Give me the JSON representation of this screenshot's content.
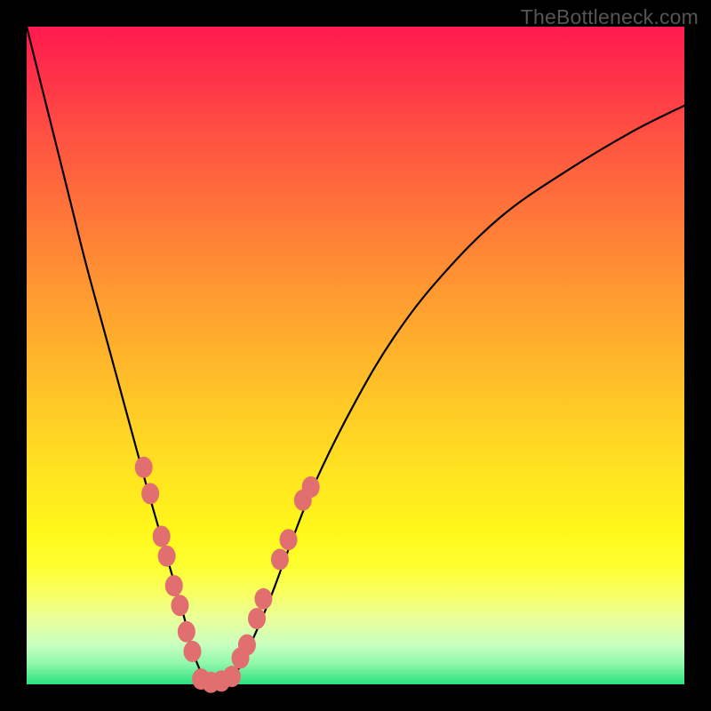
{
  "watermark": "TheBottleneck.com",
  "colors": {
    "curve": "#000000",
    "marker_fill": "#e26f6f",
    "marker_stroke": "#c75a5a",
    "background_black": "#000000"
  },
  "chart_data": {
    "type": "line",
    "title": "",
    "xlabel": "",
    "ylabel": "",
    "xlim": [
      0,
      100
    ],
    "ylim": [
      0,
      100
    ],
    "grid": false,
    "legend": false,
    "series": [
      {
        "name": "bottleneck-curve",
        "x": [
          0,
          3,
          6,
          9,
          12,
          15,
          18,
          20,
          22,
          24,
          25,
          26,
          27,
          28,
          29,
          30,
          32,
          34,
          37,
          40,
          44,
          50,
          56,
          63,
          72,
          82,
          92,
          100
        ],
        "y": [
          100,
          88,
          76,
          64,
          53,
          42,
          31,
          24,
          17,
          10,
          6,
          3,
          1,
          0,
          0,
          0,
          2,
          6,
          13,
          21,
          31,
          43,
          53,
          62,
          71,
          78,
          84,
          88
        ]
      }
    ],
    "markers_left": [
      {
        "x": 17.8,
        "y": 33
      },
      {
        "x": 18.8,
        "y": 29
      },
      {
        "x": 20.5,
        "y": 22.5
      },
      {
        "x": 21.3,
        "y": 19.5
      },
      {
        "x": 22.4,
        "y": 15
      },
      {
        "x": 23.3,
        "y": 12
      },
      {
        "x": 24.3,
        "y": 8
      },
      {
        "x": 25.2,
        "y": 5
      }
    ],
    "markers_bottom": [
      {
        "x": 26.5,
        "y": 0.8
      },
      {
        "x": 28.0,
        "y": 0.3
      },
      {
        "x": 29.6,
        "y": 0.5
      },
      {
        "x": 31.2,
        "y": 1.2
      }
    ],
    "markers_right": [
      {
        "x": 32.5,
        "y": 4
      },
      {
        "x": 33.5,
        "y": 6
      },
      {
        "x": 35.0,
        "y": 10
      },
      {
        "x": 36.0,
        "y": 13
      },
      {
        "x": 38.5,
        "y": 19
      },
      {
        "x": 39.8,
        "y": 22
      },
      {
        "x": 42.0,
        "y": 28
      },
      {
        "x": 43.2,
        "y": 30
      }
    ]
  }
}
